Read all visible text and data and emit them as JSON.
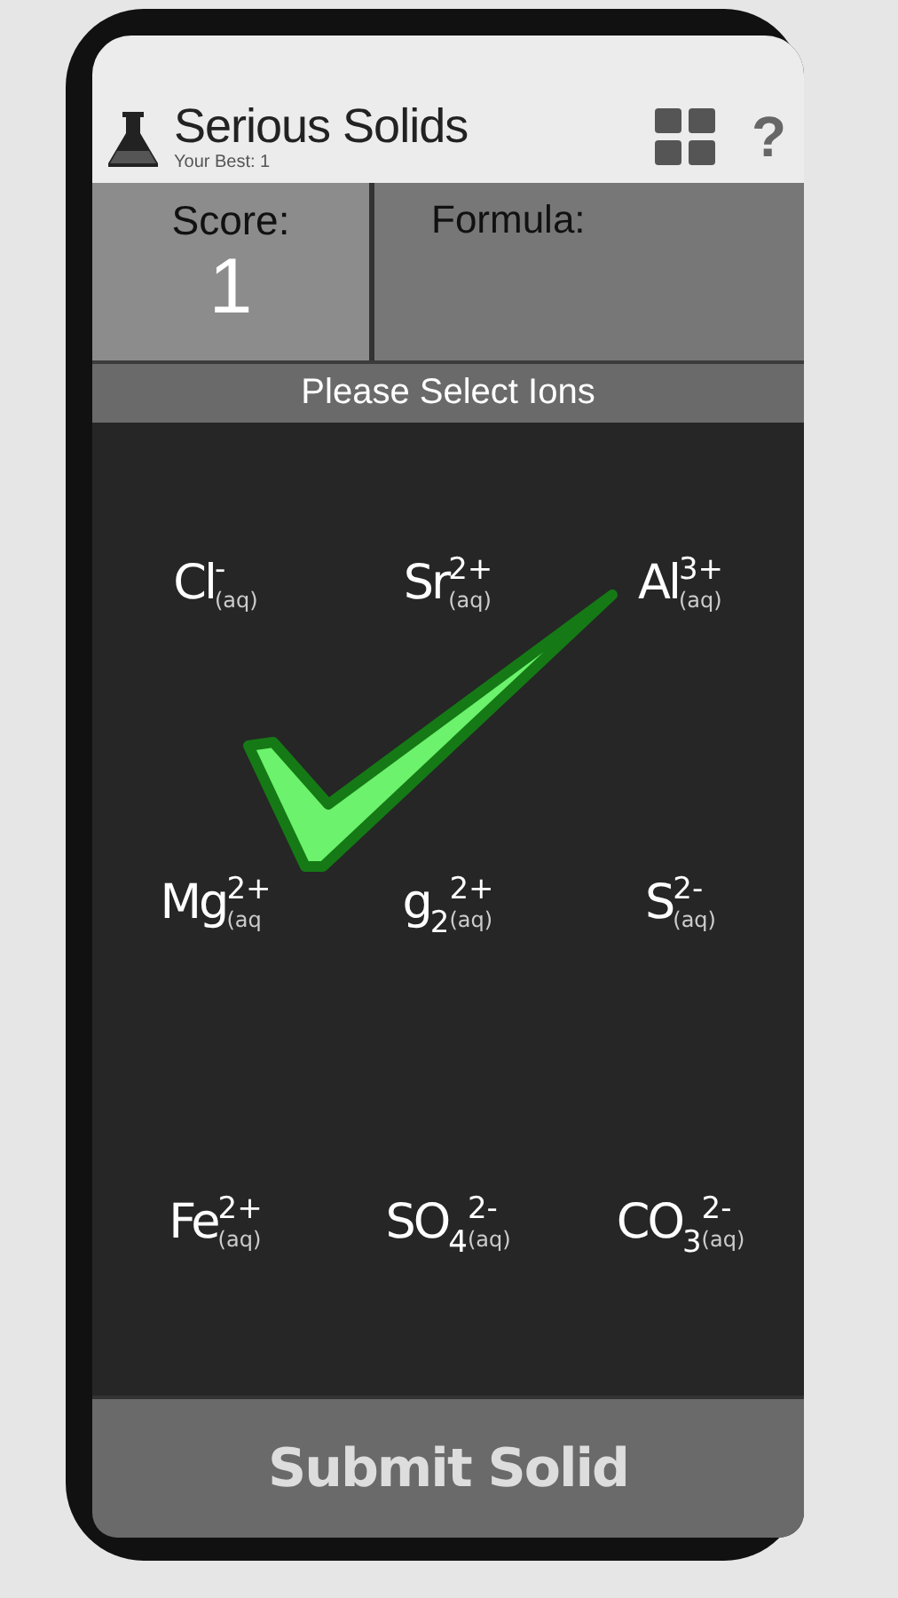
{
  "header": {
    "title": "Serious Solids",
    "subtitle": "Your Best: 1",
    "help_button": "?"
  },
  "score": {
    "label": "Score:",
    "value": "1"
  },
  "formula": {
    "label": "Formula:"
  },
  "prompt": "Please Select Ions",
  "ions": [
    {
      "symbol": "Cl",
      "charge": "-",
      "state": "(aq)"
    },
    {
      "symbol": "Sr",
      "charge": "2+",
      "state": "(aq)"
    },
    {
      "symbol": "Al",
      "charge": "3+",
      "state": "(aq)"
    },
    {
      "symbol": "Mg",
      "charge": "2+",
      "state": "(aq"
    },
    {
      "symbol": "g",
      "index": "2",
      "charge": "2+",
      "state": "(aq)"
    },
    {
      "symbol": "S",
      "charge": "2-",
      "state": "(aq)"
    },
    {
      "symbol": "Fe",
      "charge": "2+",
      "state": "(aq)"
    },
    {
      "symbol": "SO",
      "index": "4",
      "charge": "2-",
      "state": "(aq)"
    },
    {
      "symbol": "CO",
      "index": "3",
      "charge": "2-",
      "state": "(aq)"
    }
  ],
  "feedback": {
    "kind": "correct"
  },
  "submit_button": "Submit Solid"
}
